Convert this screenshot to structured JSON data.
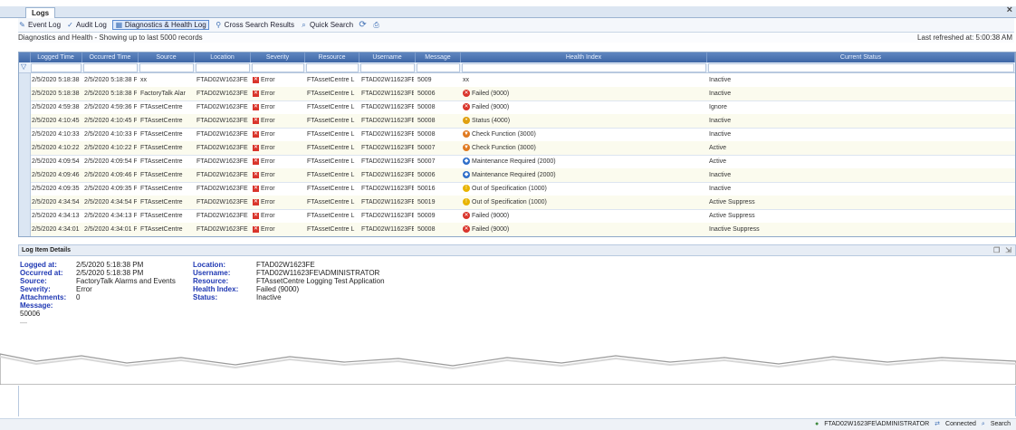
{
  "window": {
    "tab_label": "Logs",
    "close_glyph": "×"
  },
  "toolbar": {
    "items": [
      {
        "label": "Event Log",
        "icon": "event-log-icon",
        "glyph": "✎"
      },
      {
        "label": "Audit Log",
        "icon": "audit-log-icon",
        "glyph": "✓"
      },
      {
        "label": "Diagnostics & Health Log",
        "icon": "diagnostics-icon",
        "glyph": "▦",
        "selected": true
      },
      {
        "label": "Cross Search Results",
        "icon": "cross-search-icon",
        "glyph": "⚲"
      },
      {
        "label": "Quick Search",
        "icon": "quick-search-icon",
        "glyph": "⌕"
      }
    ],
    "refresh_icon": "refresh-icon",
    "refresh_glyph": "⟳",
    "print_icon": "print-icon",
    "print_glyph": "⎙"
  },
  "info": {
    "showing": "Diagnostics and Health - Showing up to last 5000 records",
    "last_refreshed": "Last refreshed at: 5:00:38 AM"
  },
  "grid": {
    "columns": [
      "Logged Time",
      "Occurred Time",
      "Source",
      "Location",
      "Severity",
      "Resource",
      "Username",
      "Message",
      "Health Index",
      "Current Status"
    ],
    "filter_icon": "filter-icon",
    "filter_glyph": "▽",
    "rows": [
      {
        "logged": "2/5/2020 5:18:38 PM",
        "occurred": "2/5/2020 5:18:38 PM",
        "source": "xx",
        "location": "FTAD02W1623FE",
        "severity": "Error",
        "resource": "FTAssetCentre L",
        "username": "FTAD02W11623FE",
        "message": "5009",
        "health": "xx",
        "health_icon": "none",
        "status": "Inactive"
      },
      {
        "logged": "2/5/2020 5:18:38 PM",
        "occurred": "2/5/2020 5:18:38 PM",
        "source": "FactoryTalk Alar",
        "location": "FTAD02W1623FE",
        "severity": "Error",
        "resource": "FTAssetCentre L",
        "username": "FTAD02W11623FE",
        "message": "50006",
        "health": "Failed (9000)",
        "health_icon": "failed",
        "status": "Inactive"
      },
      {
        "logged": "2/5/2020 4:59:38 PM",
        "occurred": "2/5/2020 4:59:36 PM",
        "source": "FTAssetCentre",
        "location": "FTAD02W1623FE",
        "severity": "Error",
        "resource": "FTAssetCentre L",
        "username": "FTAD02W11623FE",
        "message": "50008",
        "health": "Failed (9000)",
        "health_icon": "failed",
        "status": "Ignore"
      },
      {
        "logged": "2/5/2020 4:10:45 PM",
        "occurred": "2/5/2020 4:10:45 PM",
        "source": "FTAssetCentre",
        "location": "FTAD02W1623FE",
        "severity": "Error",
        "resource": "FTAssetCentre L",
        "username": "FTAD02W11623FE",
        "message": "50008",
        "health": "Status (4000)",
        "health_icon": "status",
        "status": "Inactive"
      },
      {
        "logged": "2/5/2020 4:10:33 PM",
        "occurred": "2/5/2020 4:10:33 PM",
        "source": "FTAssetCentre",
        "location": "FTAD02W1623FE",
        "severity": "Error",
        "resource": "FTAssetCentre L",
        "username": "FTAD02W11623FE",
        "message": "50008",
        "health": "Check Function (3000)",
        "health_icon": "check",
        "status": "Inactive"
      },
      {
        "logged": "2/5/2020 4:10:22 PM",
        "occurred": "2/5/2020 4:10:22 PM",
        "source": "FTAssetCentre",
        "location": "FTAD02W1623FE",
        "severity": "Error",
        "resource": "FTAssetCentre L",
        "username": "FTAD02W11623FE",
        "message": "50007",
        "health": "Check Function (3000)",
        "health_icon": "check",
        "status": "Active"
      },
      {
        "logged": "2/5/2020 4:09:54 PM",
        "occurred": "2/5/2020 4:09:54 PM",
        "source": "FTAssetCentre",
        "location": "FTAD02W1623FE",
        "severity": "Error",
        "resource": "FTAssetCentre L",
        "username": "FTAD02W11623FE",
        "message": "50007",
        "health": "Maintenance Required (2000)",
        "health_icon": "maint",
        "status": "Active"
      },
      {
        "logged": "2/5/2020 4:09:46 PM",
        "occurred": "2/5/2020 4:09:46 PM",
        "source": "FTAssetCentre",
        "location": "FTAD02W1623FE",
        "severity": "Error",
        "resource": "FTAssetCentre L",
        "username": "FTAD02W11623FE",
        "message": "50006",
        "health": "Maintenance Required (2000)",
        "health_icon": "maint",
        "status": "Inactive"
      },
      {
        "logged": "2/5/2020 4:09:35 PM",
        "occurred": "2/5/2020 4:09:35 PM",
        "source": "FTAssetCentre",
        "location": "FTAD02W1623FE",
        "severity": "Error",
        "resource": "FTAssetCentre L",
        "username": "FTAD02W11623FE",
        "message": "50016",
        "health": "Out of Specification (1000)",
        "health_icon": "oos",
        "status": "Inactive"
      },
      {
        "logged": "2/5/2020 4:34:54 PM",
        "occurred": "2/5/2020 4:34:54 PM",
        "source": "FTAssetCentre",
        "location": "FTAD02W1623FE",
        "severity": "Error",
        "resource": "FTAssetCentre L",
        "username": "FTAD02W11623FE",
        "message": "50019",
        "health": "Out of Specification (1000)",
        "health_icon": "oos",
        "status": "Active Suppress"
      },
      {
        "logged": "2/5/2020 4:34:13 PM",
        "occurred": "2/5/2020 4:34:13 PM",
        "source": "FTAssetCentre",
        "location": "FTAD02W1623FE",
        "severity": "Error",
        "resource": "FTAssetCentre L",
        "username": "FTAD02W11623FE",
        "message": "50009",
        "health": "Failed (9000)",
        "health_icon": "failed",
        "status": "Active Suppress"
      },
      {
        "logged": "2/5/2020 4:34:01 PM",
        "occurred": "2/5/2020 4:34:01 PM",
        "source": "FTAssetCentre",
        "location": "FTAD02W1623FE",
        "severity": "Error",
        "resource": "FTAssetCentre L",
        "username": "FTAD02W11623FE",
        "message": "50008",
        "health": "Failed (9000)",
        "health_icon": "failed",
        "status": "Inactive Suppress"
      }
    ]
  },
  "details": {
    "header": "Log Item Details",
    "logged_at_label": "Logged at:",
    "logged_at": "2/5/2020 5:18:38 PM",
    "occurred_at_label": "Occurred at:",
    "occurred_at": "2/5/2020 5:18:38 PM",
    "source_label": "Source:",
    "source": "FactoryTalk Alarms and Events",
    "severity_label": "Severity:",
    "severity": "Error",
    "attachments_label": "Attachments:",
    "attachments": "0",
    "message_label": "Message:",
    "message": "50006",
    "location_label": "Location:",
    "location": "FTAD02W1623FE",
    "username_label": "Username:",
    "username": "FTAD02W11623FE\\ADMINISTRATOR",
    "resource_label": "Resource:",
    "resource": "FTAssetCentre Logging Test Application",
    "health_label": "Health Index:",
    "health": "Failed (9000)",
    "status_label": "Status:",
    "status": "Inactive",
    "copy_icon": "copy-icon",
    "copy_glyph": "❐",
    "export_icon": "export-icon",
    "export_glyph": "⇲"
  },
  "statusbar": {
    "user": "FTAD02W1623FE\\ADMINISTRATOR",
    "connection": "Connected",
    "search": "Search"
  },
  "colors": {
    "header_blue": "#4a72b0",
    "accent": "#1f38b3",
    "error_red": "#d9342b"
  }
}
